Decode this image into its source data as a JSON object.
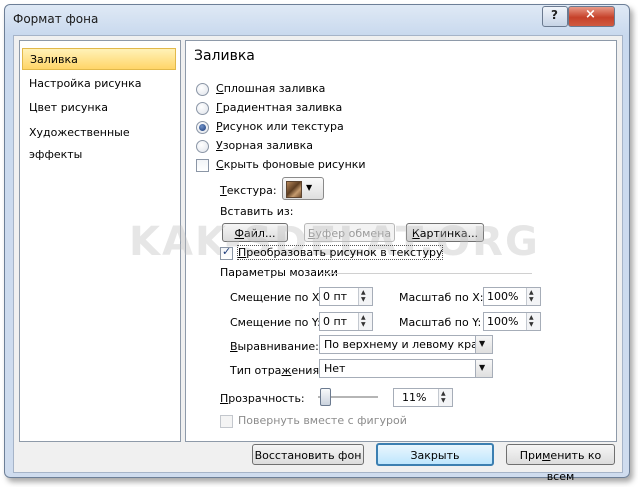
{
  "window": {
    "title": "Формат фона",
    "help_icon": "?",
    "close_icon": "×"
  },
  "nav": {
    "items": [
      {
        "label": "Заливка"
      },
      {
        "label": "Настройка рисунка"
      },
      {
        "label": "Цвет рисунка"
      },
      {
        "label": "Художественные эффекты"
      }
    ]
  },
  "fill": {
    "heading": "Заливка",
    "options": [
      {
        "label": "Сплошная заливка",
        "underline": "С",
        "rest": "плошная заливка"
      },
      {
        "label": "Градиентная заливка",
        "underline": "Г",
        "rest": "радиентная заливка"
      },
      {
        "label": "Рисунок или текстура",
        "underline": "Р",
        "rest": "исунок или текстура"
      },
      {
        "label": "Узорная заливка",
        "underline": "У",
        "rest": "зорная заливка"
      }
    ],
    "selected_option": "Рисунок или текстура",
    "hide_bg": {
      "underline": "С",
      "rest": "крыть фоновые рисунки"
    },
    "texture_label_u": "Т",
    "texture_label_rest": "екстура:",
    "insert_from": "Вставить из:",
    "file_button_u": "Ф",
    "file_button_rest": "айл...",
    "clipboard_button_u": "Б",
    "clipboard_button_rest": "уфер обмена",
    "clipart_button_u": "К",
    "clipart_button_rest": "артинка...",
    "tile_checkbox_u": "П",
    "tile_checkbox_rest": "реобразовать рисунок в текстуру",
    "tile_checked": true,
    "tiling_heading": "Параметры мозаики",
    "offset_x": {
      "label": "Смещение по X:",
      "value": "0 пт"
    },
    "offset_y": {
      "label": "Смещение по Y:",
      "value": "0 пт"
    },
    "scale_x": {
      "label": "Масштаб по X:",
      "value": "100%"
    },
    "scale_y": {
      "label": "Масштаб по Y:",
      "value": "100%"
    },
    "alignment": {
      "label_u": "В",
      "label_rest": "ыравнивание:",
      "value": "По верхнему и левому краю"
    },
    "mirror": {
      "label_a": "Тип отра",
      "label_u": "ж",
      "label_b": "ения:",
      "value": "Нет"
    },
    "transparency": {
      "label_u": "П",
      "label_rest": "розрачность:",
      "value": "11%",
      "fraction": 0.11
    },
    "rotate_with_shape": "Повернуть вместе с фигурой"
  },
  "footer": {
    "reset_label": "Восстановить фон",
    "close_label": "Закрыть",
    "apply_all_a": "При",
    "apply_all_u": "м",
    "apply_all_b": "енить ко всем"
  },
  "watermark": "KAK-SDELAT.ORG",
  "colors": {
    "selection": "#ffd568",
    "window_frame": "#c9d9ee",
    "close_red": "#c6412a"
  }
}
